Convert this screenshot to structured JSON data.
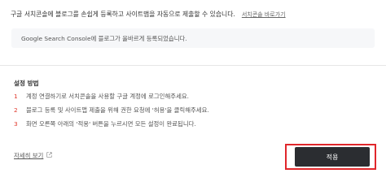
{
  "intro": {
    "text": "구글 서치콘솔에 블로그를 손쉽게 등록하고 사이트맵을 자동으로 제출할 수 있습니다.",
    "link_label": "서치콘솔 바로가기"
  },
  "status": {
    "text": "Google Search Console에 블로그가 올바르게 등록되었습니다."
  },
  "steps": {
    "title": "설정 방법",
    "items": [
      {
        "num": "1",
        "text": "계정 연결하기로 서치콘솔을 사용할 구글 계정에 로그인해주세요."
      },
      {
        "num": "2",
        "text": "블로그 등록 및 사이트맵 제출을 위해 권한 요청에 '허용'을 클릭해주세요."
      },
      {
        "num": "3",
        "text": "화면 오른쪽 아래의 '적용' 버튼을 누르시면 모든 설정이 완료됩니다."
      }
    ]
  },
  "footer": {
    "link_label": "자세히 보기"
  },
  "actions": {
    "apply_label": "적용"
  },
  "colors": {
    "accent_number": "#e03b2f",
    "highlight_border": "#e0262b",
    "button_bg": "#2b2d31"
  }
}
